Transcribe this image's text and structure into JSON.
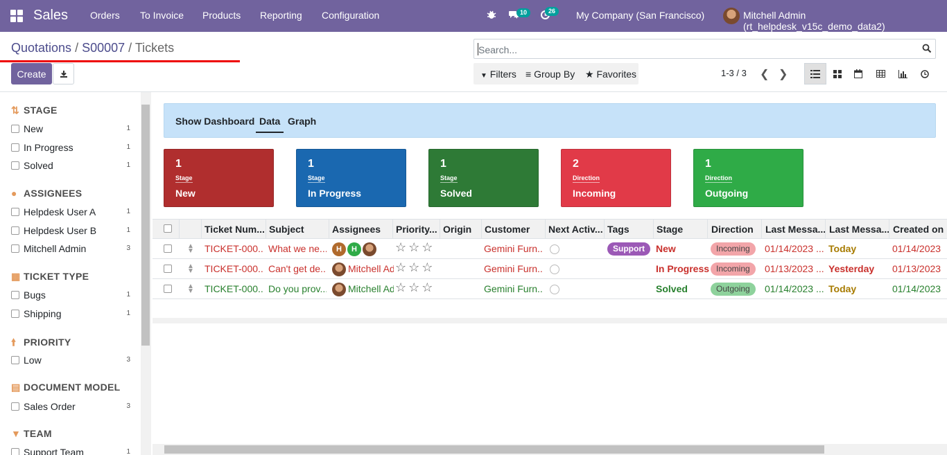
{
  "navbar": {
    "brand": "Sales",
    "menu": [
      "Orders",
      "To Invoice",
      "Products",
      "Reporting",
      "Configuration"
    ],
    "messages_count": "10",
    "activities_count": "26",
    "company": "My Company (San Francisco)",
    "user": "Mitchell Admin (rt_helpdesk_v15c_demo_data2)"
  },
  "breadcrumb": {
    "part1": "Quotations",
    "sep1": " / ",
    "part2": "S00007",
    "sep2": " / ",
    "current": "Tickets"
  },
  "buttons": {
    "create": "Create"
  },
  "search": {
    "placeholder": "Search..."
  },
  "filters": {
    "filters": "Filters",
    "group_by": "Group By",
    "favorites": "Favorites"
  },
  "pager": {
    "text": "1-3 / 3"
  },
  "sidebar": {
    "sections": [
      {
        "title": "STAGE",
        "icon": "refresh-icon",
        "items": [
          {
            "label": "New",
            "count": "1"
          },
          {
            "label": "In Progress",
            "count": "1"
          },
          {
            "label": "Solved",
            "count": "1"
          }
        ]
      },
      {
        "title": "ASSIGNEES",
        "icon": "user-icon",
        "items": [
          {
            "label": "Helpdesk User A",
            "count": "1"
          },
          {
            "label": "Helpdesk User B",
            "count": "1"
          },
          {
            "label": "Mitchell Admin",
            "count": "3"
          }
        ]
      },
      {
        "title": "TICKET TYPE",
        "icon": "grid-icon",
        "items": [
          {
            "label": "Bugs",
            "count": "1"
          },
          {
            "label": "Shipping",
            "count": "1"
          }
        ]
      },
      {
        "title": "PRIORITY",
        "icon": "arrow-up-icon",
        "items": [
          {
            "label": "Low",
            "count": "3"
          }
        ]
      },
      {
        "title": "DOCUMENT MODEL",
        "icon": "file-icon",
        "items": [
          {
            "label": "Sales Order",
            "count": "3"
          }
        ]
      },
      {
        "title": "TEAM",
        "icon": "filter-icon",
        "items": [
          {
            "label": "Support Team",
            "count": "1"
          }
        ]
      }
    ]
  },
  "dashboard": {
    "tabs": [
      "Show Dashboard",
      "Data",
      "Graph"
    ],
    "cards": [
      {
        "count": "1",
        "label": "Stage",
        "value": "New",
        "color": "#b02e2e"
      },
      {
        "count": "1",
        "label": "Stage",
        "value": "In Progress",
        "color": "#1a68b0"
      },
      {
        "count": "1",
        "label": "Stage",
        "value": "Solved",
        "color": "#2e7a36"
      },
      {
        "count": "2",
        "label": "Direction",
        "value": "Incoming",
        "color": "#e13a48"
      },
      {
        "count": "1",
        "label": "Direction",
        "value": "Outgoing",
        "color": "#2fab47"
      }
    ]
  },
  "table": {
    "headers": [
      "Ticket Num...",
      "Subject",
      "Assignees",
      "Priority...",
      "Origin",
      "Customer",
      "Next Activ...",
      "Tags",
      "Stage",
      "Direction",
      "Last Messa...",
      "Last Messa...",
      "Created on"
    ],
    "rows": [
      {
        "ticket": "TICKET-000...",
        "subject": "What we ne...",
        "assignee": "",
        "tag": "Support",
        "stage": "New",
        "direction": "Incoming",
        "last1": "01/14/2023 ...",
        "last2": "Today",
        "created": "01/14/2023",
        "customer": "Gemini Furn...",
        "color": "red"
      },
      {
        "ticket": "TICKET-000...",
        "subject": "Can't get de...",
        "assignee": "Mitchell Adı",
        "tag": "",
        "stage": "In Progress",
        "direction": "Incoming",
        "last1": "01/13/2023 ...",
        "last2": "Yesterday",
        "created": "01/13/2023",
        "customer": "Gemini Furn...",
        "color": "red"
      },
      {
        "ticket": "TICKET-000...",
        "subject": "Do you prov...",
        "assignee": "Mitchell Adı",
        "tag": "",
        "stage": "Solved",
        "direction": "Outgoing",
        "last1": "01/14/2023 ...",
        "last2": "Today",
        "created": "01/14/2023",
        "customer": "Gemini Furn...",
        "color": "green"
      }
    ],
    "avatar_initials": [
      "H",
      "H"
    ]
  },
  "colors": {
    "navbar": "#71639e",
    "incoming_pill": "#f2a5a9",
    "outgoing_pill": "#8ed29c",
    "support_tag": "#9b59b6"
  }
}
